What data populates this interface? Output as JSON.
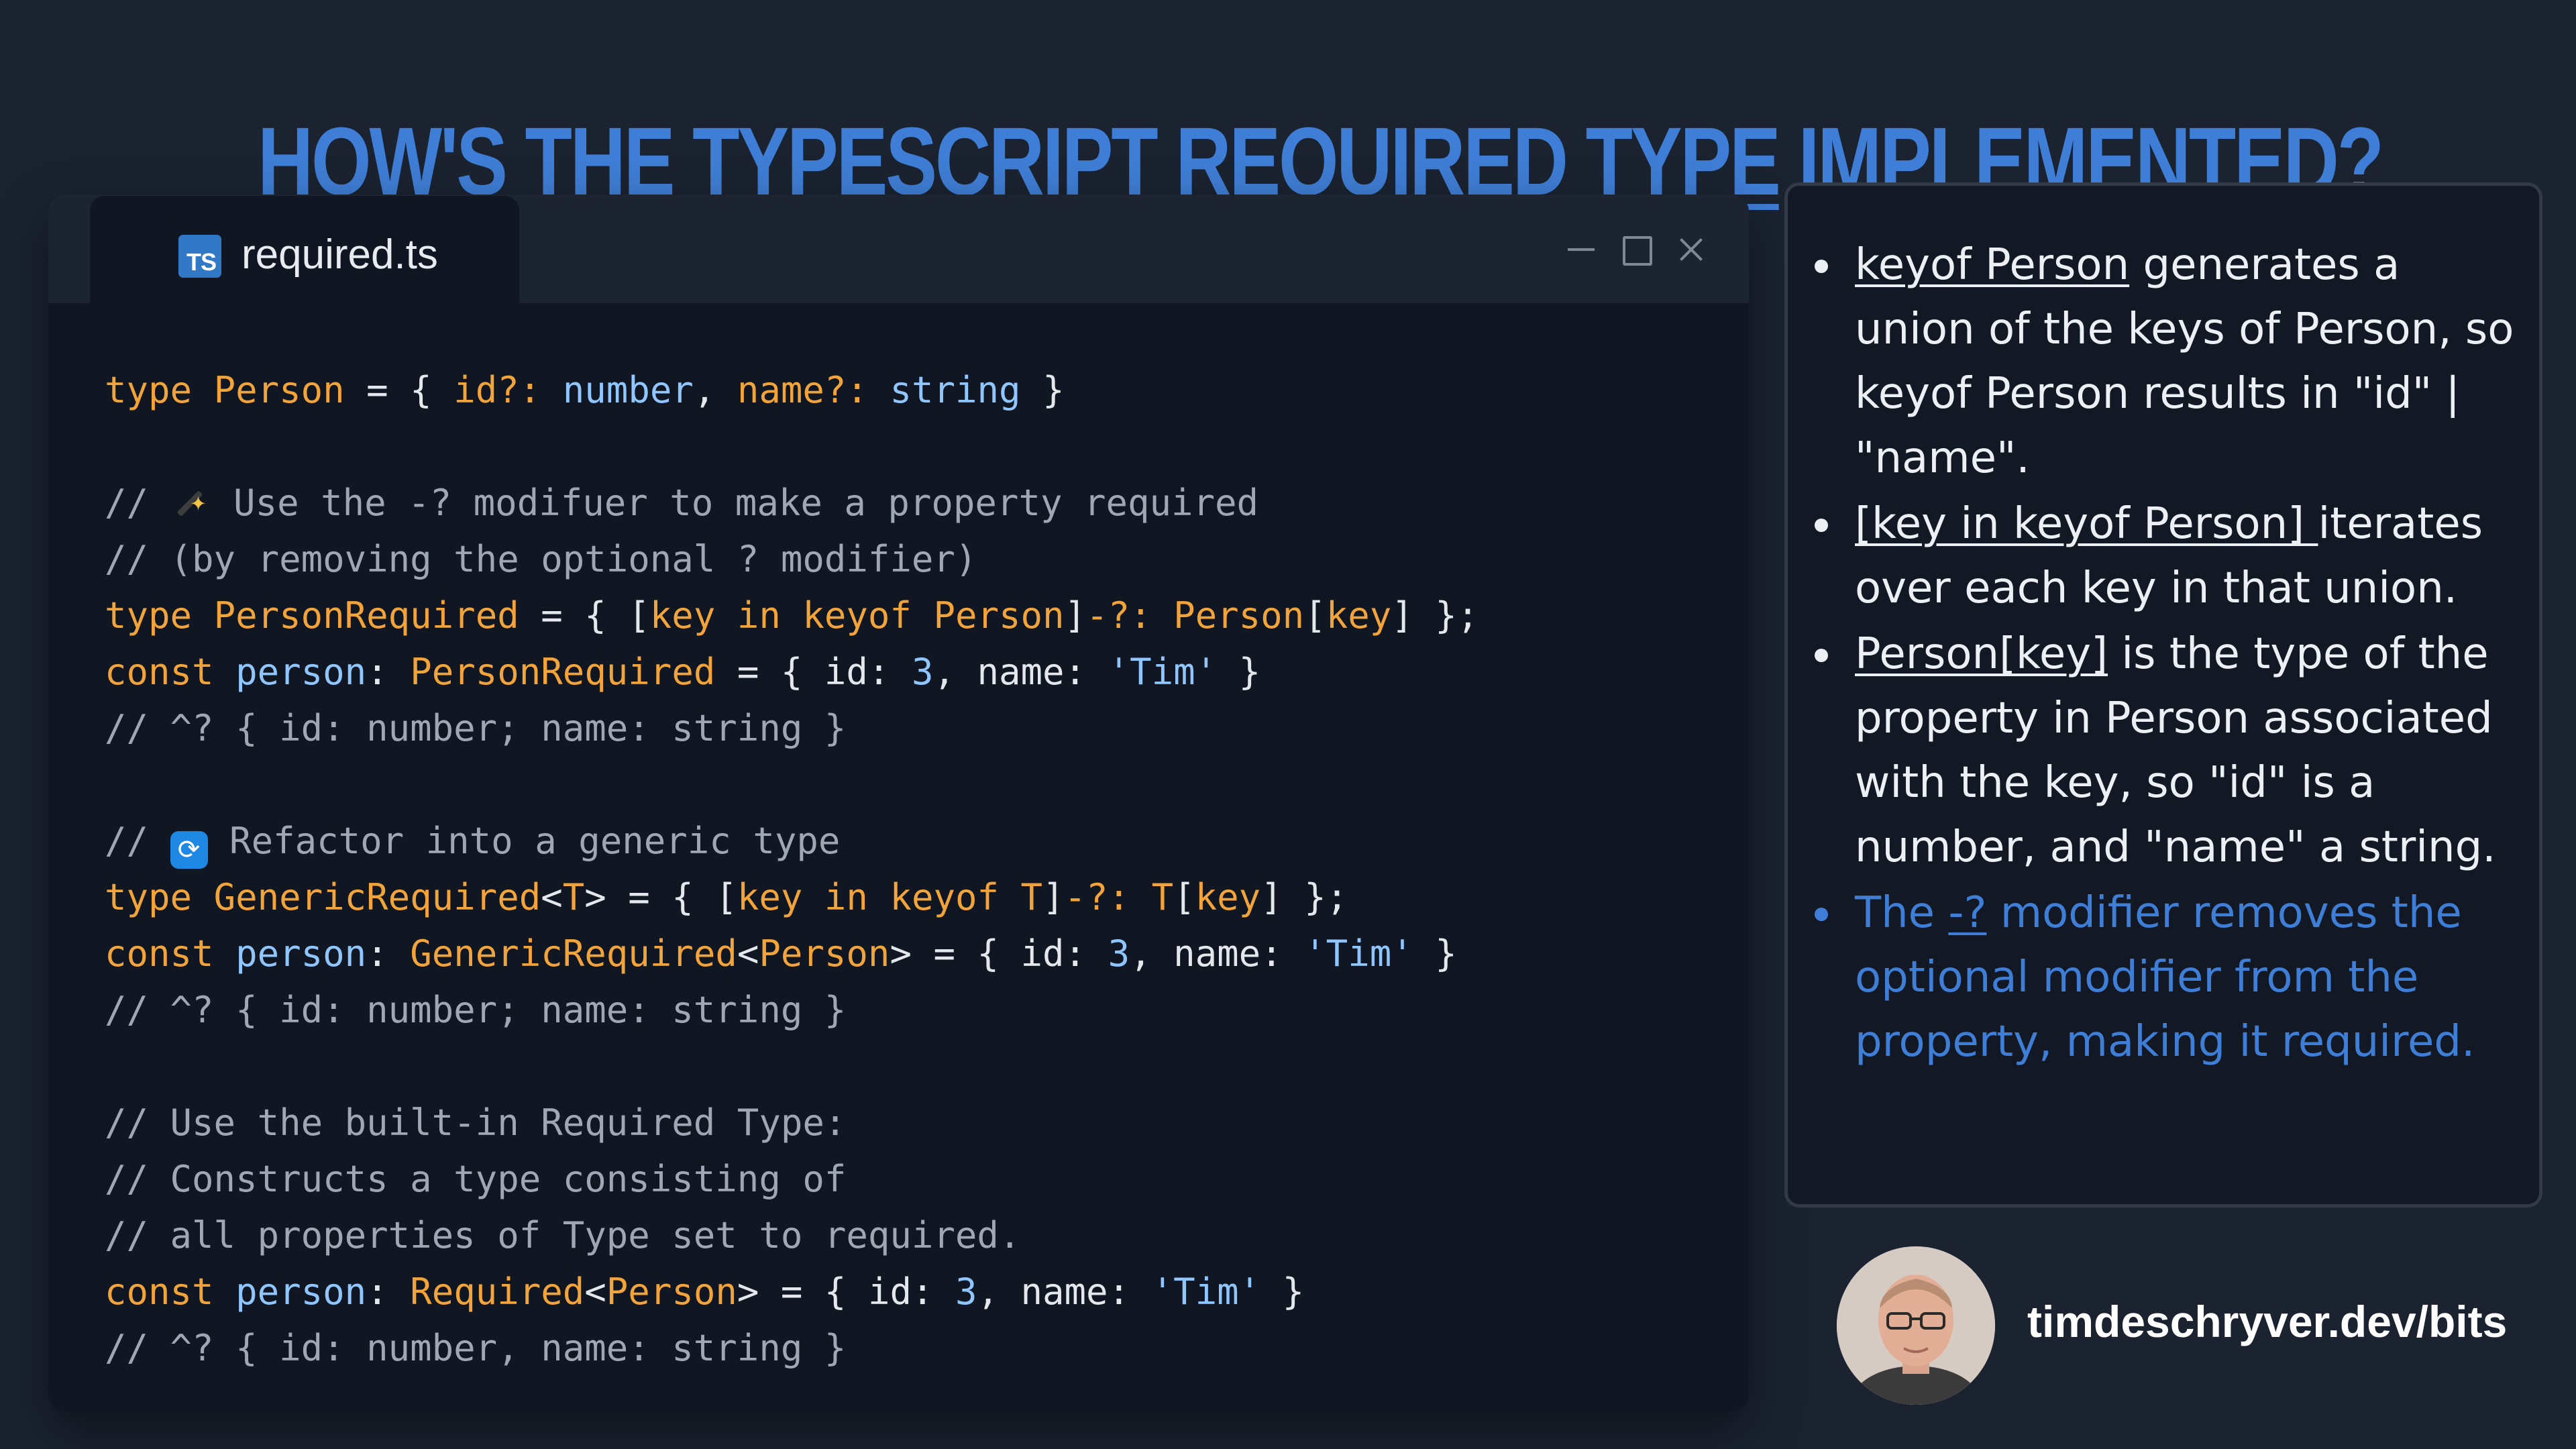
{
  "title": {
    "before": "HOW'S THE TYPESCRIPT ",
    "underlined": "REQUIRED TYPE",
    "after": " IMPLEMENTED?"
  },
  "editor": {
    "tab_icon_text": "TS",
    "tab_label": "required.ts",
    "code_lines": [
      [
        [
          "kw",
          "type"
        ],
        [
          "pl",
          " "
        ],
        [
          "ty",
          "Person"
        ],
        [
          "pl",
          " = { "
        ],
        [
          "ty",
          "id"
        ],
        [
          "kw",
          "?:"
        ],
        [
          "pl",
          " "
        ],
        [
          "va",
          "number"
        ],
        [
          "pl",
          ", "
        ],
        [
          "ty",
          "name"
        ],
        [
          "kw",
          "?:"
        ],
        [
          "pl",
          " "
        ],
        [
          "va",
          "string"
        ],
        [
          "pl",
          " }"
        ]
      ],
      [],
      [
        [
          "cm",
          "// "
        ],
        [
          "wand",
          ""
        ],
        [
          "cm",
          " Use the -? modifuer to make a property required"
        ]
      ],
      [
        [
          "cm",
          "// (by removing the optional ? modifier)"
        ]
      ],
      [
        [
          "kw",
          "type"
        ],
        [
          "pl",
          " "
        ],
        [
          "ty",
          "PersonRequired"
        ],
        [
          "pl",
          " = { ["
        ],
        [
          "ty",
          "key"
        ],
        [
          "pl",
          " "
        ],
        [
          "kw",
          "in keyof"
        ],
        [
          "pl",
          " "
        ],
        [
          "ty",
          "Person"
        ],
        [
          "pl",
          "]"
        ],
        [
          "kw",
          "-?:"
        ],
        [
          "pl",
          " "
        ],
        [
          "ty",
          "Person"
        ],
        [
          "pl",
          "["
        ],
        [
          "ty",
          "key"
        ],
        [
          "pl",
          "] };"
        ]
      ],
      [
        [
          "kw",
          "const"
        ],
        [
          "pl",
          " "
        ],
        [
          "va",
          "person"
        ],
        [
          "pl",
          ": "
        ],
        [
          "ty",
          "PersonRequired"
        ],
        [
          "pl",
          " = { id: "
        ],
        [
          "num",
          "3"
        ],
        [
          "pl",
          ", name: "
        ],
        [
          "str",
          "'Tim'"
        ],
        [
          "pl",
          " }"
        ]
      ],
      [
        [
          "cm",
          "// ^? { id: number; name: string }"
        ]
      ],
      [],
      [
        [
          "cm",
          "// "
        ],
        [
          "refresh",
          "🔁"
        ],
        [
          "cm",
          " Refactor into a generic type"
        ]
      ],
      [
        [
          "kw",
          "type"
        ],
        [
          "pl",
          " "
        ],
        [
          "ty",
          "GenericRequired"
        ],
        [
          "pl",
          "<"
        ],
        [
          "ty",
          "T"
        ],
        [
          "pl",
          "> = { ["
        ],
        [
          "ty",
          "key"
        ],
        [
          "pl",
          " "
        ],
        [
          "kw",
          "in keyof"
        ],
        [
          "pl",
          " "
        ],
        [
          "ty",
          "T"
        ],
        [
          "pl",
          "]"
        ],
        [
          "kw",
          "-?:"
        ],
        [
          "pl",
          " "
        ],
        [
          "ty",
          "T"
        ],
        [
          "pl",
          "["
        ],
        [
          "ty",
          "key"
        ],
        [
          "pl",
          "] };"
        ]
      ],
      [
        [
          "kw",
          "const"
        ],
        [
          "pl",
          " "
        ],
        [
          "va",
          "person"
        ],
        [
          "pl",
          ": "
        ],
        [
          "ty",
          "GenericRequired"
        ],
        [
          "pl",
          "<"
        ],
        [
          "ty",
          "Person"
        ],
        [
          "pl",
          "> = { id: "
        ],
        [
          "num",
          "3"
        ],
        [
          "pl",
          ", name: "
        ],
        [
          "str",
          "'Tim'"
        ],
        [
          "pl",
          " }"
        ]
      ],
      [
        [
          "cm",
          "// ^? { id: number; name: string }"
        ]
      ],
      [],
      [
        [
          "cm",
          "// Use the built-in Required Type:"
        ]
      ],
      [
        [
          "cm",
          "// Constructs a type consisting of"
        ]
      ],
      [
        [
          "cm",
          "// all properties of Type set to required."
        ]
      ],
      [
        [
          "kw",
          "const"
        ],
        [
          "pl",
          " "
        ],
        [
          "va",
          "person"
        ],
        [
          "pl",
          ": "
        ],
        [
          "ty",
          "Required"
        ],
        [
          "pl",
          "<"
        ],
        [
          "ty",
          "Person"
        ],
        [
          "pl",
          "> = { id: "
        ],
        [
          "num",
          "3"
        ],
        [
          "pl",
          ", name: "
        ],
        [
          "str",
          "'Tim'"
        ],
        [
          "pl",
          " }"
        ]
      ],
      [
        [
          "cm",
          "// ^? { id: number, name: string }"
        ]
      ]
    ]
  },
  "notes": [
    {
      "parts": [
        [
          "u",
          "keyof Person"
        ],
        [
          "t",
          " generates a union of the keys of Person, so keyof Person results in  \"id\" | \"name\"."
        ]
      ],
      "color": "#eceff4"
    },
    {
      "parts": [
        [
          "u",
          "[key in keyof Person] "
        ],
        [
          "t",
          "iterates over each key in that union."
        ]
      ],
      "color": "#eceff4"
    },
    {
      "parts": [
        [
          "u",
          "Person[key]"
        ],
        [
          "t",
          " is the type of the property in Person associated with the key, so \"id\" is a number, and \"name\" a string."
        ]
      ],
      "color": "#eceff4"
    },
    {
      "parts": [
        [
          "t",
          "The "
        ],
        [
          "u",
          "-?"
        ],
        [
          "t",
          " modifier removes the optional modifier from the property, making it required."
        ]
      ],
      "color": "#3f7ed6"
    }
  ],
  "author": {
    "link": "timdeschryver.dev/bits",
    "avatar_icon": "person-photo"
  },
  "colors": {
    "background": "#1b2331",
    "accent": "#3f7ed6",
    "keyword": "#f2a33a",
    "value": "#8fc6ff",
    "comment": "#a0a7b4"
  }
}
